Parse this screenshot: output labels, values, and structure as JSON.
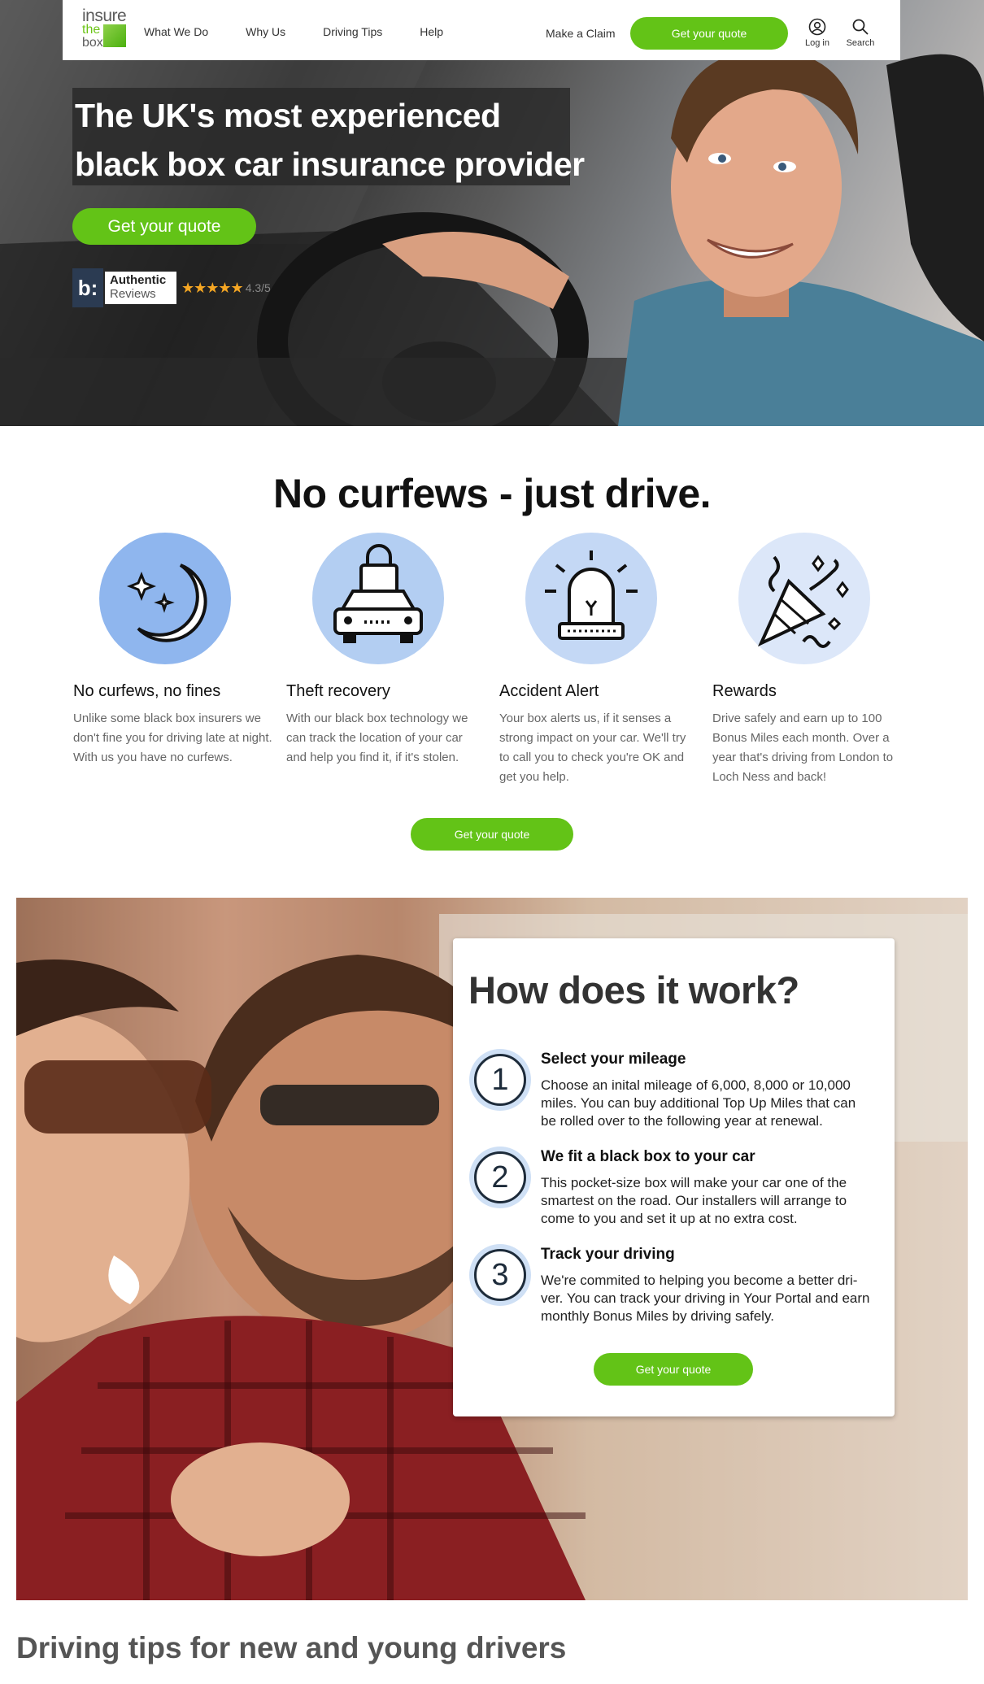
{
  "brand": {
    "logo_line1": "insure",
    "logo_line2": "the",
    "logo_line3": "box"
  },
  "nav": {
    "items": [
      {
        "label": "What We Do"
      },
      {
        "label": "Why Us"
      },
      {
        "label": "Driving Tips"
      },
      {
        "label": "Help"
      }
    ],
    "make_claim": "Make a Claim",
    "quote_button": "Get your quote",
    "login_label": "Log in",
    "search_label": "Search"
  },
  "hero": {
    "title_line1": "The UK's most experienced",
    "title_line2": "black box car insurance provider",
    "quote_button": "Get your quote",
    "reviews": {
      "logo": "b:",
      "line1": "Authentic",
      "line2": "Reviews",
      "stars": "★★★★★",
      "score": "4.3/5",
      "rating": 4.3
    }
  },
  "features": {
    "title": "No curfews - just drive.",
    "items": [
      {
        "icon": "moon-stars-icon",
        "title": "No curfews, no fines",
        "text": "Unlike some black box insurers we don't fine you for driving late at night. With us you have no curfews.",
        "color": "#8fb6ee"
      },
      {
        "icon": "car-lock-icon",
        "title": "Theft recovery",
        "text": "With our black box technology we can track the location of your car and help you find it, if it's stolen.",
        "color": "#b3cef2"
      },
      {
        "icon": "siren-icon",
        "title": "Accident Alert",
        "text": "Your box alerts us, if it senses a strong impact on your car. We'll try to call you to check you're OK and get you help.",
        "color": "#c4d8f5"
      },
      {
        "icon": "party-popper-icon",
        "title": "Rewards",
        "text": "Drive safely and earn up to 100 Bonus Miles each month. Over a year that's driving from London to Loch Ness and back!",
        "color": "#dce7f9"
      }
    ],
    "quote_button": "Get your quote"
  },
  "how": {
    "title": "How does it work?",
    "steps": [
      {
        "number": "1",
        "title": "Select your mileage",
        "text": "Choose an inital mileage of 6,000, 8,000 or 10,000 miles. You can buy additional Top Up Miles that can be rolled over to the following year at renewal."
      },
      {
        "number": "2",
        "title": "We fit a black box to your car",
        "text": "This pocket-size box will make your car one of the smartest on the road. Our installers will arrange to come to you and set it up at no extra cost."
      },
      {
        "number": "3",
        "title": "Track your driving",
        "text": "We're commited to helping you become a better dri-ver. You can track your driving in Your Portal and earn monthly Bonus Miles by driving safely."
      }
    ],
    "quote_button": "Get your quote"
  },
  "tips": {
    "title": "Driving tips for new and young drivers"
  },
  "colors": {
    "accent_green": "#63c317",
    "dark_navy": "#1d2b3a"
  }
}
